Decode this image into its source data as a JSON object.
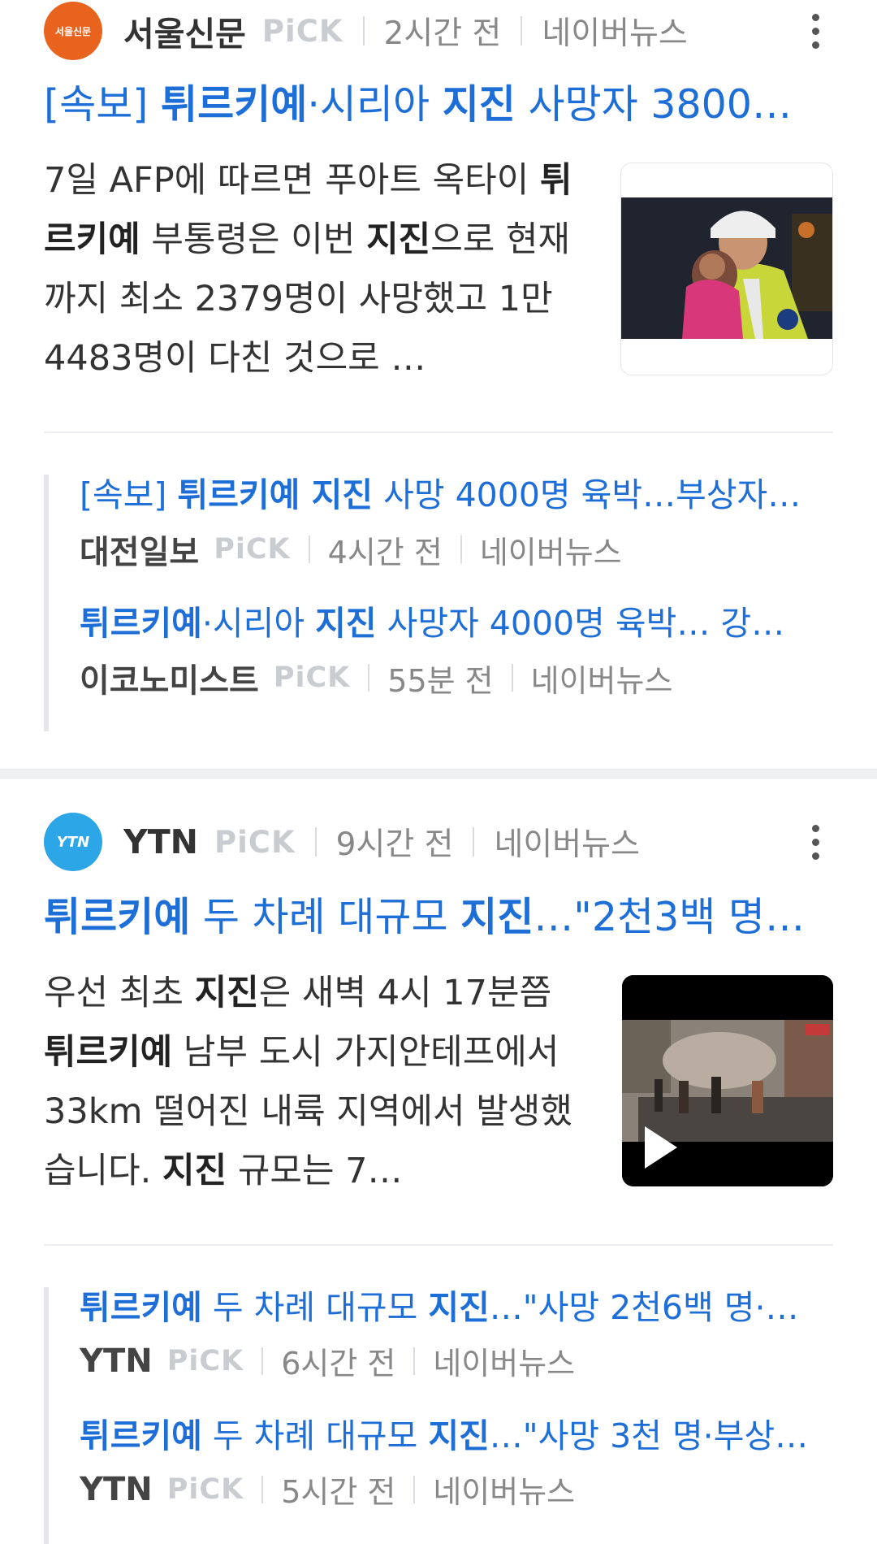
{
  "articles": [
    {
      "source": "서울신문",
      "logo_text": "서울신문",
      "pick": "PiCK",
      "time": "2시간 전",
      "platform": "네이버뉴스",
      "headline": [
        {
          "t": "[속보] ",
          "b": false
        },
        {
          "t": "튀르키예",
          "b": true
        },
        {
          "t": "·시리아 ",
          "b": false
        },
        {
          "t": "지진",
          "b": true
        },
        {
          "t": " 사망자 3800…",
          "b": false
        }
      ],
      "body": [
        {
          "t": "7일 AFP에 따르면 푸아트 옥타이 ",
          "b": false
        },
        {
          "t": "튀르키예",
          "b": true
        },
        {
          "t": " 부통령은 이번 ",
          "b": false
        },
        {
          "t": "지진",
          "b": true
        },
        {
          "t": "으로 현재까지 최소 2379명이 사망했고 1만 4483명이 다친 것으로 …",
          "b": false
        }
      ],
      "related": [
        {
          "title": [
            {
              "t": "[속보] ",
              "b": false
            },
            {
              "t": "튀르키예 지진",
              "b": true
            },
            {
              "t": " 사망 4000명 육박…부상자…",
              "b": false
            }
          ],
          "source": "대전일보",
          "pick": "PiCK",
          "time": "4시간 전",
          "platform": "네이버뉴스"
        },
        {
          "title": [
            {
              "t": "튀르키예",
              "b": true
            },
            {
              "t": "·시리아 ",
              "b": false
            },
            {
              "t": "지진",
              "b": true
            },
            {
              "t": " 사망자 4000명 육박… 강…",
              "b": false
            }
          ],
          "source": "이코노미스트",
          "pick": "PiCK",
          "time": "55분 전",
          "platform": "네이버뉴스"
        }
      ]
    },
    {
      "source": "YTN",
      "logo_text": "YTN",
      "pick": "PiCK",
      "time": "9시간 전",
      "platform": "네이버뉴스",
      "headline": [
        {
          "t": "튀르키예",
          "b": true
        },
        {
          "t": " 두 차례 대규모 ",
          "b": false
        },
        {
          "t": "지진",
          "b": true
        },
        {
          "t": "…\"2천3백 명…",
          "b": false
        }
      ],
      "body": [
        {
          "t": "우선 최초 ",
          "b": false
        },
        {
          "t": "지진",
          "b": true
        },
        {
          "t": "은 새벽 4시 17분쯤 ",
          "b": false
        },
        {
          "t": "튀르키예",
          "b": true
        },
        {
          "t": " 남부 도시 가지안테프에서 33km 떨어진 내륙 지역에서 발생했습니다. ",
          "b": false
        },
        {
          "t": "지진",
          "b": true
        },
        {
          "t": " 규모는 7…",
          "b": false
        }
      ],
      "related": [
        {
          "title": [
            {
              "t": "튀르키예",
              "b": true
            },
            {
              "t": " 두 차례 대규모 ",
              "b": false
            },
            {
              "t": "지진",
              "b": true
            },
            {
              "t": "…\"사망 2천6백 명·…",
              "b": false
            }
          ],
          "source": "YTN",
          "pick": "PiCK",
          "time": "6시간 전",
          "platform": "네이버뉴스"
        },
        {
          "title": [
            {
              "t": "튀르키예",
              "b": true
            },
            {
              "t": " 두 차례 대규모 ",
              "b": false
            },
            {
              "t": "지진",
              "b": true
            },
            {
              "t": "…\"사망 3천 명·부상…",
              "b": false
            }
          ],
          "source": "YTN",
          "pick": "PiCK",
          "time": "5시간 전",
          "platform": "네이버뉴스"
        }
      ]
    }
  ]
}
